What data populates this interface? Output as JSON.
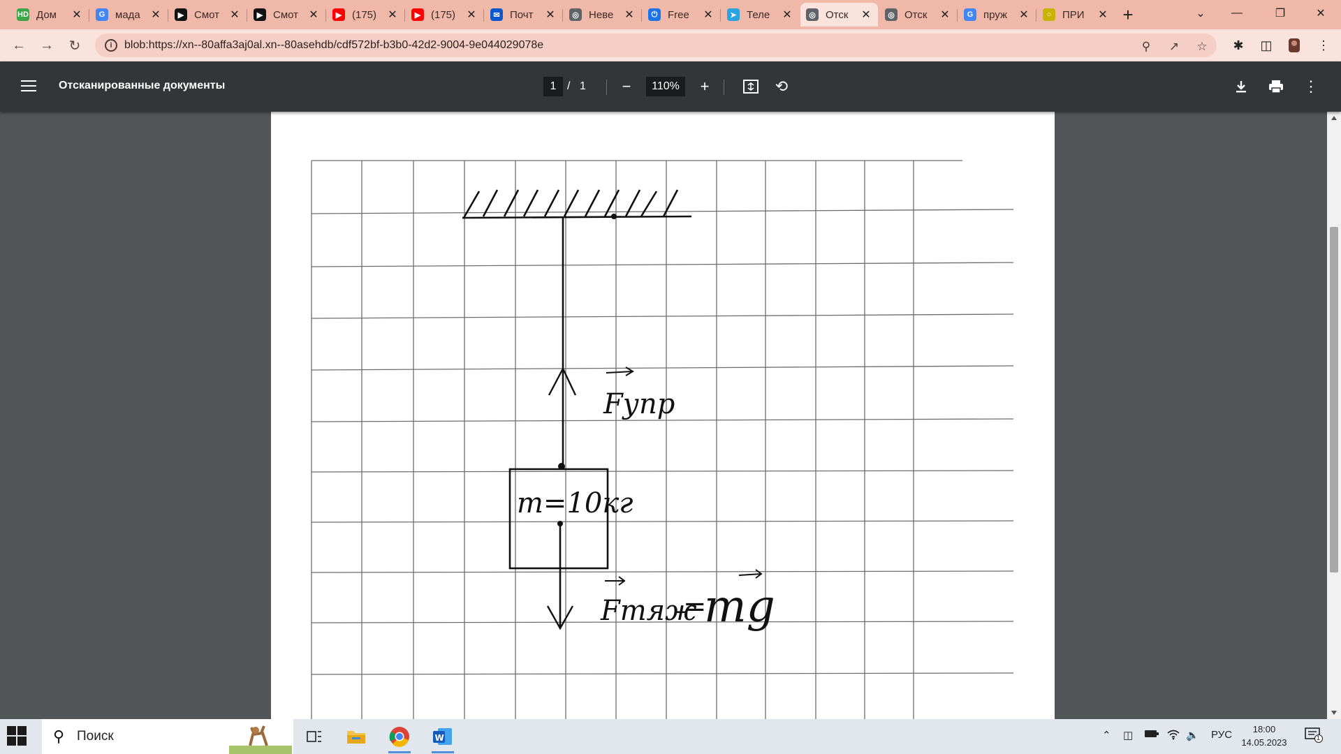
{
  "browser": {
    "tabs": [
      {
        "label": "Дом",
        "icon": "hd-icon",
        "color": "#3aa647"
      },
      {
        "label": "мада",
        "icon": "google-icon",
        "color": "#4285f4"
      },
      {
        "label": "Смот",
        "icon": "play-icon",
        "color": "#111111"
      },
      {
        "label": "Смот",
        "icon": "play-icon",
        "color": "#111111"
      },
      {
        "label": "(175)",
        "icon": "youtube-icon",
        "color": "#ff0000"
      },
      {
        "label": "(175)",
        "icon": "youtube-icon",
        "color": "#ff0000"
      },
      {
        "label": "Почт",
        "icon": "mail-icon",
        "color": "#0b57d0"
      },
      {
        "label": "Неве",
        "icon": "globe-icon",
        "color": "#5f6368"
      },
      {
        "label": "Free",
        "icon": "power-icon",
        "color": "#1a73e8"
      },
      {
        "label": "Теле",
        "icon": "telegram-icon",
        "color": "#2aa3e0"
      },
      {
        "label": "Отск",
        "icon": "globe-icon",
        "color": "#5f6368",
        "active": true
      },
      {
        "label": "Отск",
        "icon": "globe-icon",
        "color": "#5f6368"
      },
      {
        "label": "пруж",
        "icon": "google-icon",
        "color": "#4285f4"
      },
      {
        "label": "ПРИ",
        "icon": "circle-icon",
        "color": "#c8b400"
      }
    ],
    "new_tab_symbol": "+",
    "url": "blob:https://xn--80affa3aj0al.xn--80asehdb/cdf572bf-b3b0-42d2-9004-9e044029078e"
  },
  "pdf": {
    "title": "Отсканированные документы",
    "page_current": "1",
    "page_separator": "/",
    "page_total": "1",
    "zoom": "110%"
  },
  "sketch": {
    "block_label": "m=10кг",
    "force_up": "Fупр",
    "force_down": "Fтяж",
    "equals": "=",
    "mg": "mg"
  },
  "taskbar": {
    "search_placeholder": "Поиск",
    "language": "РУС",
    "time": "18:00",
    "date": "14.05.2023",
    "notification_count": "1"
  }
}
